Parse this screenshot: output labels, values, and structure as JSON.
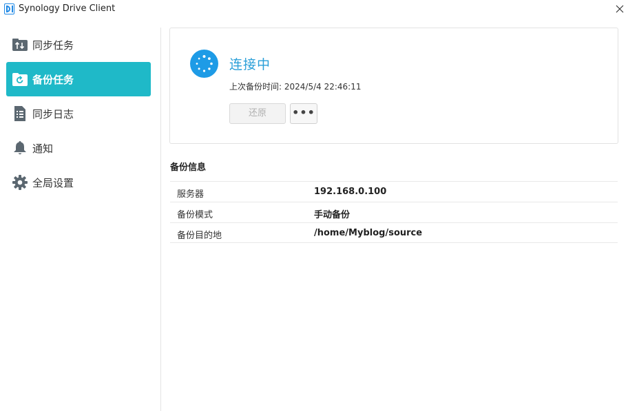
{
  "window": {
    "title": "Synology Drive Client"
  },
  "sidebar": {
    "items": [
      {
        "label": "同步任务",
        "icon": "sync-arrows-icon",
        "active": false
      },
      {
        "label": "备份任务",
        "icon": "backup-folder-icon",
        "active": true
      },
      {
        "label": "同步日志",
        "icon": "log-document-icon",
        "active": false
      },
      {
        "label": "通知",
        "icon": "bell-icon",
        "active": false
      },
      {
        "label": "全局设置",
        "icon": "gear-icon",
        "active": false
      }
    ]
  },
  "status": {
    "icon": "loading-spinner-icon",
    "title": "连接中",
    "last_backup": "上次备份时间: 2024/5/4 22:46:11",
    "restore_label": "还原",
    "more_label": "•••"
  },
  "backup_info": {
    "title": "备份信息",
    "rows": [
      {
        "key": "服务器",
        "value": "192.168.0.100"
      },
      {
        "key": "备份模式",
        "value": "手动备份"
      },
      {
        "key": "备份目的地",
        "value": "/home/Myblog/source"
      }
    ]
  },
  "colors": {
    "accent": "#1fb9c8",
    "status_blue": "#1e9be6",
    "status_text": "#2a9fd8"
  }
}
